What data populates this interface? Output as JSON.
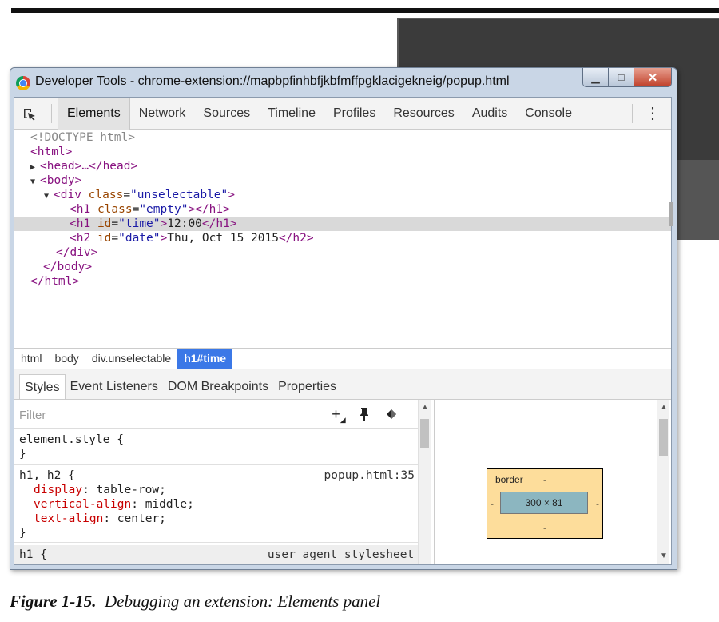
{
  "window": {
    "title": "Developer Tools - chrome-extension://mapbpfinhbfjkbfmffpgklacigekneig/popup.html",
    "min_glyph": "▁",
    "max_glyph": "□",
    "close_glyph": "✕"
  },
  "toolbar": {
    "tabs": [
      {
        "label": "Elements",
        "active": true
      },
      {
        "label": "Network"
      },
      {
        "label": "Sources"
      },
      {
        "label": "Timeline"
      },
      {
        "label": "Profiles"
      },
      {
        "label": "Resources"
      },
      {
        "label": "Audits"
      },
      {
        "label": "Console"
      }
    ],
    "more_glyph": "⋮"
  },
  "dom_tree": {
    "doctype": "<!DOCTYPE html>",
    "html_open": "<html>",
    "head_collapsed": "<head>…</head>",
    "body_open": "<body>",
    "div_tag_open": "<div",
    "div_attr": "class",
    "div_val": "\"unselectable\"",
    "h1_empty_open": "<h1",
    "h1_empty_attr": "class",
    "h1_empty_val": "\"empty\"",
    "h1_empty_close": "></h1>",
    "h1_time_open": "<h1",
    "h1_time_attr": "id",
    "h1_time_val": "\"time\"",
    "h1_time_text": "12:00",
    "h1_time_close": "</h1>",
    "h2_date_open": "<h2",
    "h2_date_attr": "id",
    "h2_date_val": "\"date\"",
    "h2_date_text": "Thu, Oct 15 2015",
    "h2_date_close": "</h2>",
    "div_close": "</div>",
    "body_close": "</body>",
    "html_close": "</html>"
  },
  "breadcrumbs": [
    {
      "label": "html"
    },
    {
      "label": "body"
    },
    {
      "label": "div.unselectable"
    },
    {
      "label": "h1#time",
      "active": true
    }
  ],
  "subtabs": [
    {
      "label": "Styles",
      "active": true
    },
    {
      "label": "Event Listeners"
    },
    {
      "label": "DOM Breakpoints"
    },
    {
      "label": "Properties"
    }
  ],
  "styles": {
    "filter_placeholder": "Filter",
    "element_style_selector": "element.style {",
    "element_style_close": "}",
    "rule1_selector": "h1, h2 {",
    "rule1_source": "popup.html:35",
    "rule1_props": [
      {
        "name": "display",
        "value": "table-row;"
      },
      {
        "name": "vertical-align",
        "value": "middle;"
      },
      {
        "name": "text-align",
        "value": "center;"
      }
    ],
    "rule1_close": "}",
    "rule2_selector": "h1 {",
    "rule2_source": "user agent stylesheet"
  },
  "metrics": {
    "border_label": "border",
    "dash": "-",
    "content_size": "300 × 81"
  },
  "caption": {
    "figure": "Figure 1-15.",
    "text": "Debugging an extension: Elements panel"
  }
}
